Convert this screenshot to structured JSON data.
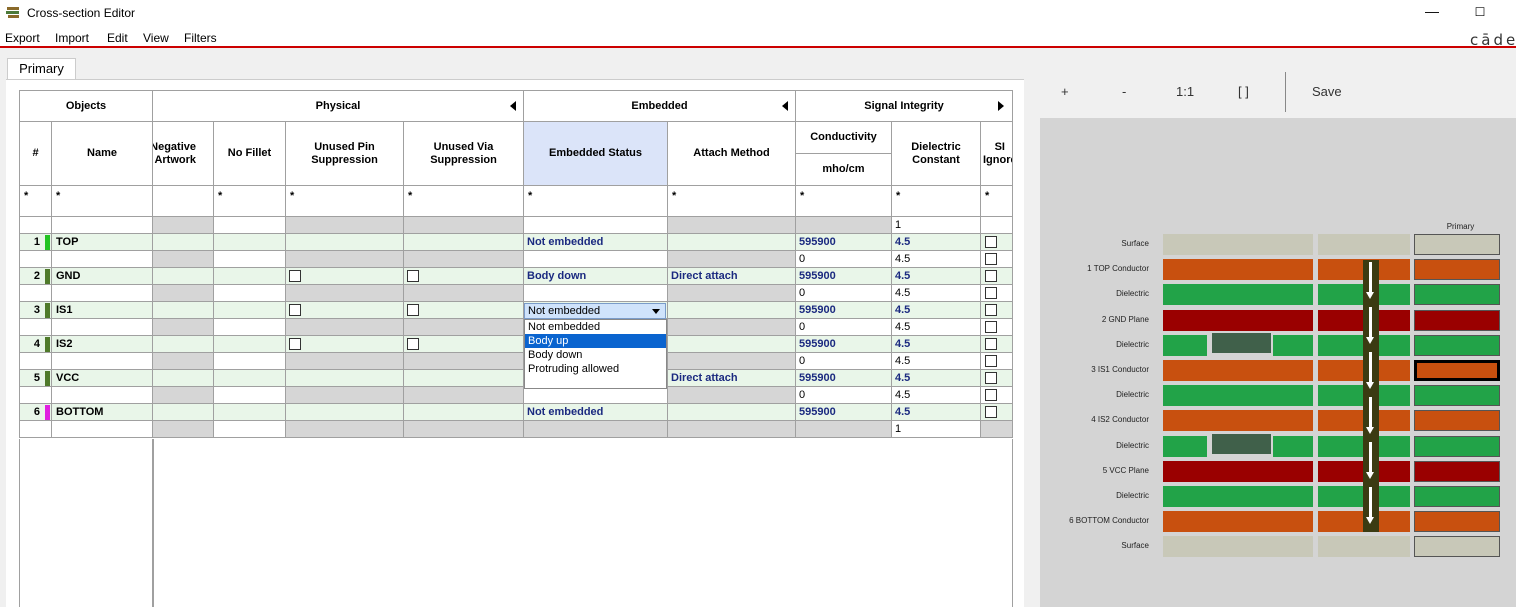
{
  "window": {
    "title": "Cross-section Editor",
    "minimize": "—",
    "maximize": "☐"
  },
  "menu": {
    "items": [
      "Export",
      "Import",
      "Edit",
      "View",
      "Filters"
    ],
    "brand": "cāden"
  },
  "tabs": {
    "primary": "Primary"
  },
  "grid": {
    "groups": {
      "objects": "Objects",
      "physical": "Physical",
      "embedded": "Embedded",
      "signal_integrity": "Signal Integrity"
    },
    "columns": {
      "num": "#",
      "name": "Name",
      "negative_artwork": "Negative Artwork",
      "no_fillet": "No Fillet",
      "unused_pin": "Unused Pin Suppression",
      "unused_via": "Unused Via Suppression",
      "embedded_status": "Embedded Status",
      "attach_method": "Attach Method",
      "conductivity": "Conductivity",
      "conductivity_unit": "mho/cm",
      "dielectric_constant": "Dielectric Constant",
      "si_ignore": "SI Ignore"
    },
    "filter": "*",
    "surface_dk": "1",
    "rows": [
      {
        "num": "1",
        "name": "TOP",
        "color": "#22c322",
        "embedded": "Not embedded",
        "attach": "",
        "conductivity": "595900",
        "dk": "4.5",
        "pinbox": false,
        "below_cond": "0",
        "below_dk": "4.5"
      },
      {
        "num": "2",
        "name": "GND",
        "color": "#4f7a2a",
        "embedded": "Body down",
        "attach": "Direct attach",
        "conductivity": "595900",
        "dk": "4.5",
        "pinbox": true,
        "below_cond": "0",
        "below_dk": "4.5"
      },
      {
        "num": "3",
        "name": "IS1",
        "color": "#4f7a2a",
        "embedded": "",
        "attach": "",
        "conductivity": "595900",
        "dk": "4.5",
        "pinbox": true,
        "below_cond": "0",
        "below_dk": "4.5"
      },
      {
        "num": "4",
        "name": "IS2",
        "color": "#4f7a2a",
        "embedded": "",
        "attach": "",
        "conductivity": "595900",
        "dk": "4.5",
        "pinbox": true,
        "below_cond": "0",
        "below_dk": "4.5"
      },
      {
        "num": "5",
        "name": "VCC",
        "color": "#4f7a2a",
        "embedded": "",
        "attach": "Direct attach",
        "conductivity": "595900",
        "dk": "4.5",
        "pinbox": false,
        "below_cond": "0",
        "below_dk": "4.5"
      },
      {
        "num": "6",
        "name": "BOTTOM",
        "color": "#e020e0",
        "embedded": "Not embedded",
        "attach": "",
        "conductivity": "595900",
        "dk": "4.5",
        "pinbox": false,
        "below_cond": "",
        "below_dk": "1"
      }
    ],
    "dropdown": {
      "value": "Not embedded",
      "options": [
        "Not embedded",
        "Body up",
        "Body down",
        "Protruding allowed"
      ],
      "highlighted": "Body up"
    }
  },
  "viewer": {
    "tools": {
      "zoom_in": "+",
      "zoom_out": "-",
      "fit": "1:1",
      "frame": "[ ]",
      "save": "Save"
    },
    "column_title": "Primary",
    "layers": [
      "Surface",
      "1   TOP Conductor",
      "Dielectric",
      "2   GND Plane",
      "Dielectric",
      "3   IS1 Conductor",
      "Dielectric",
      "4   IS2 Conductor",
      "Dielectric",
      "5   VCC Plane",
      "Dielectric",
      "6   BOTTOM Conductor",
      "Surface"
    ],
    "layer_types": [
      "surface",
      "conductor",
      "dielectric",
      "plane",
      "dielectric-cavity",
      "conductor-selected",
      "dielectric",
      "conductor",
      "dielectric-cavity",
      "plane",
      "dielectric",
      "conductor",
      "surface"
    ],
    "colors": {
      "surface": "#c8c8b8",
      "conductor": "#c8500f",
      "dielectric": "#22a348",
      "plane": "#9a0000",
      "cavity": "#40604a",
      "via": "#3b3b12"
    }
  }
}
